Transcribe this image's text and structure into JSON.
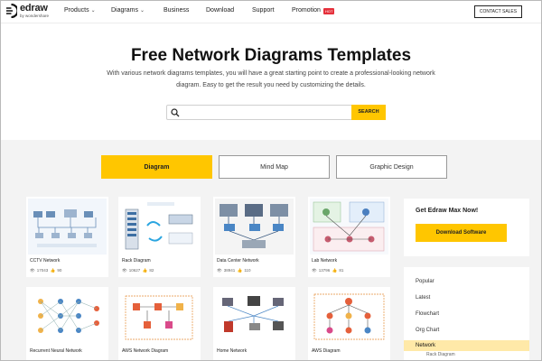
{
  "header": {
    "logo_word": "edraw",
    "logo_sub": "by wondershare",
    "nav": [
      {
        "label": "Products",
        "dropdown": true
      },
      {
        "label": "Diagrams",
        "dropdown": true
      },
      {
        "label": "Business",
        "dropdown": false
      },
      {
        "label": "Download",
        "dropdown": false
      },
      {
        "label": "Support",
        "dropdown": false
      },
      {
        "label": "Promotion",
        "dropdown": false
      }
    ],
    "hot_badge": "HOT",
    "contact_label": "CONTACT SALES"
  },
  "hero": {
    "title": "Free Network Diagrams Templates",
    "subtitle": "With various network diagrams templates, you will have a great starting point to create a professional-looking network diagram. Easy to get the result you need by customizing the details.",
    "search": {
      "value": "",
      "placeholder": "",
      "button_label": "SEARCH"
    }
  },
  "tabs": [
    {
      "label": "Diagram",
      "active": true
    },
    {
      "label": "Mind Map",
      "active": false
    },
    {
      "label": "Graphic Design",
      "active": false
    }
  ],
  "cards": [
    {
      "title": "CCTV Network",
      "views": "17043",
      "likes": "90"
    },
    {
      "title": "Rack Diagram",
      "views": "10627",
      "likes": "82"
    },
    {
      "title": "Data Center Network",
      "views": "38941",
      "likes": "110"
    },
    {
      "title": "Lab Network",
      "views": "13796",
      "likes": "81"
    },
    {
      "title": "Recurrent Neural Network",
      "views": "",
      "likes": ""
    },
    {
      "title": "AWS Network Diagram",
      "views": "",
      "likes": ""
    },
    {
      "title": "Home Network",
      "views": "",
      "likes": ""
    },
    {
      "title": "AWS Diagram",
      "views": "",
      "likes": ""
    }
  ],
  "sidebar": {
    "promo_title": "Get Edraw Max Now!",
    "promo_button": "Download Software",
    "categories": [
      {
        "label": "Popular",
        "active": false
      },
      {
        "label": "Latest",
        "active": false
      },
      {
        "label": "Flowchart",
        "active": false
      },
      {
        "label": "Org Chart",
        "active": false
      },
      {
        "label": "Network",
        "active": true
      }
    ],
    "sub_category": "Rack Diagram"
  },
  "colors": {
    "accent": "#ffc600",
    "hot": "#e5303b",
    "content_bg": "#f3f3f3"
  }
}
